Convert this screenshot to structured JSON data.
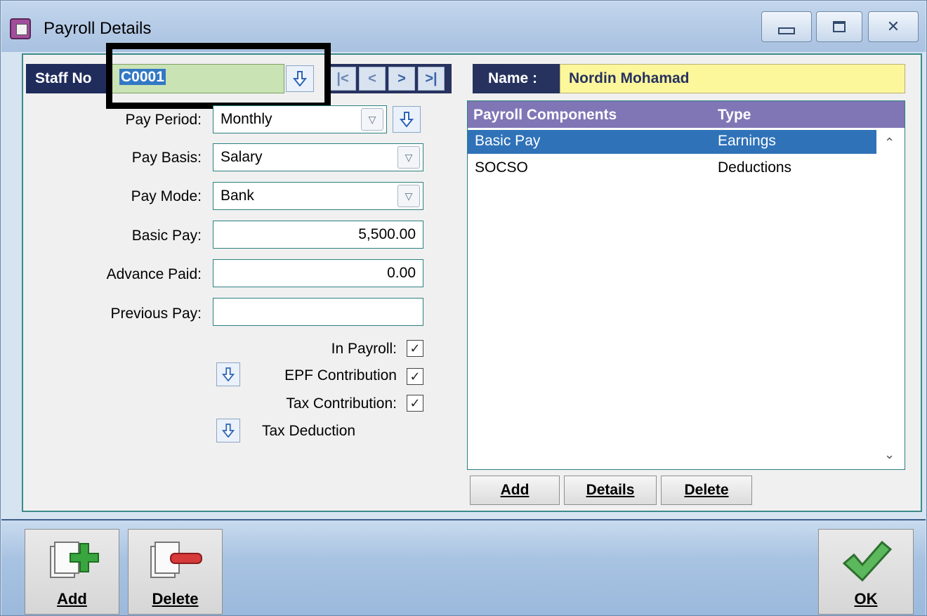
{
  "window": {
    "title": "Payroll Details",
    "controls": {
      "minimize": "minimize-icon",
      "maximize": "maximize-icon",
      "close": "close-icon"
    }
  },
  "header": {
    "staff_no_label": "Staff No",
    "staff_no_value": "C0001",
    "name_label": "Name :",
    "name_value": "Nordin Mohamad"
  },
  "form": {
    "pay_period": {
      "label": "Pay Period:",
      "value": "Monthly"
    },
    "pay_basis": {
      "label": "Pay Basis:",
      "value": "Salary"
    },
    "pay_mode": {
      "label": "Pay Mode:",
      "value": "Bank"
    },
    "basic_pay": {
      "label": "Basic Pay:",
      "value": "5,500.00"
    },
    "advance_paid": {
      "label": "Advance Paid:",
      "value": "0.00"
    },
    "previous_pay": {
      "label": "Previous Pay:",
      "value": ""
    },
    "in_payroll": {
      "label": "In Payroll:",
      "checked": true
    },
    "epf_contribution": {
      "label": "EPF Contribution",
      "checked": true
    },
    "tax_contribution": {
      "label": "Tax Contribution:",
      "checked": true
    },
    "tax_deduction": {
      "label": "Tax Deduction"
    }
  },
  "components": {
    "headers": [
      "Payroll Components",
      "Type"
    ],
    "rows": [
      {
        "component": "Basic Pay",
        "type": "Earnings",
        "selected": true
      },
      {
        "component": "SOCSO",
        "type": "Deductions",
        "selected": false
      }
    ],
    "buttons": {
      "add": "Add",
      "details": "Details",
      "delete": "Delete"
    }
  },
  "footer": {
    "add_label": "Add",
    "delete_label": "Delete",
    "ok_label": "OK"
  },
  "colors": {
    "accent_navy": "#27325f",
    "list_header": "#8076b6",
    "selection": "#2f72b8",
    "name_bg": "#fdf79b",
    "staff_bg": "#c9e3b4"
  }
}
